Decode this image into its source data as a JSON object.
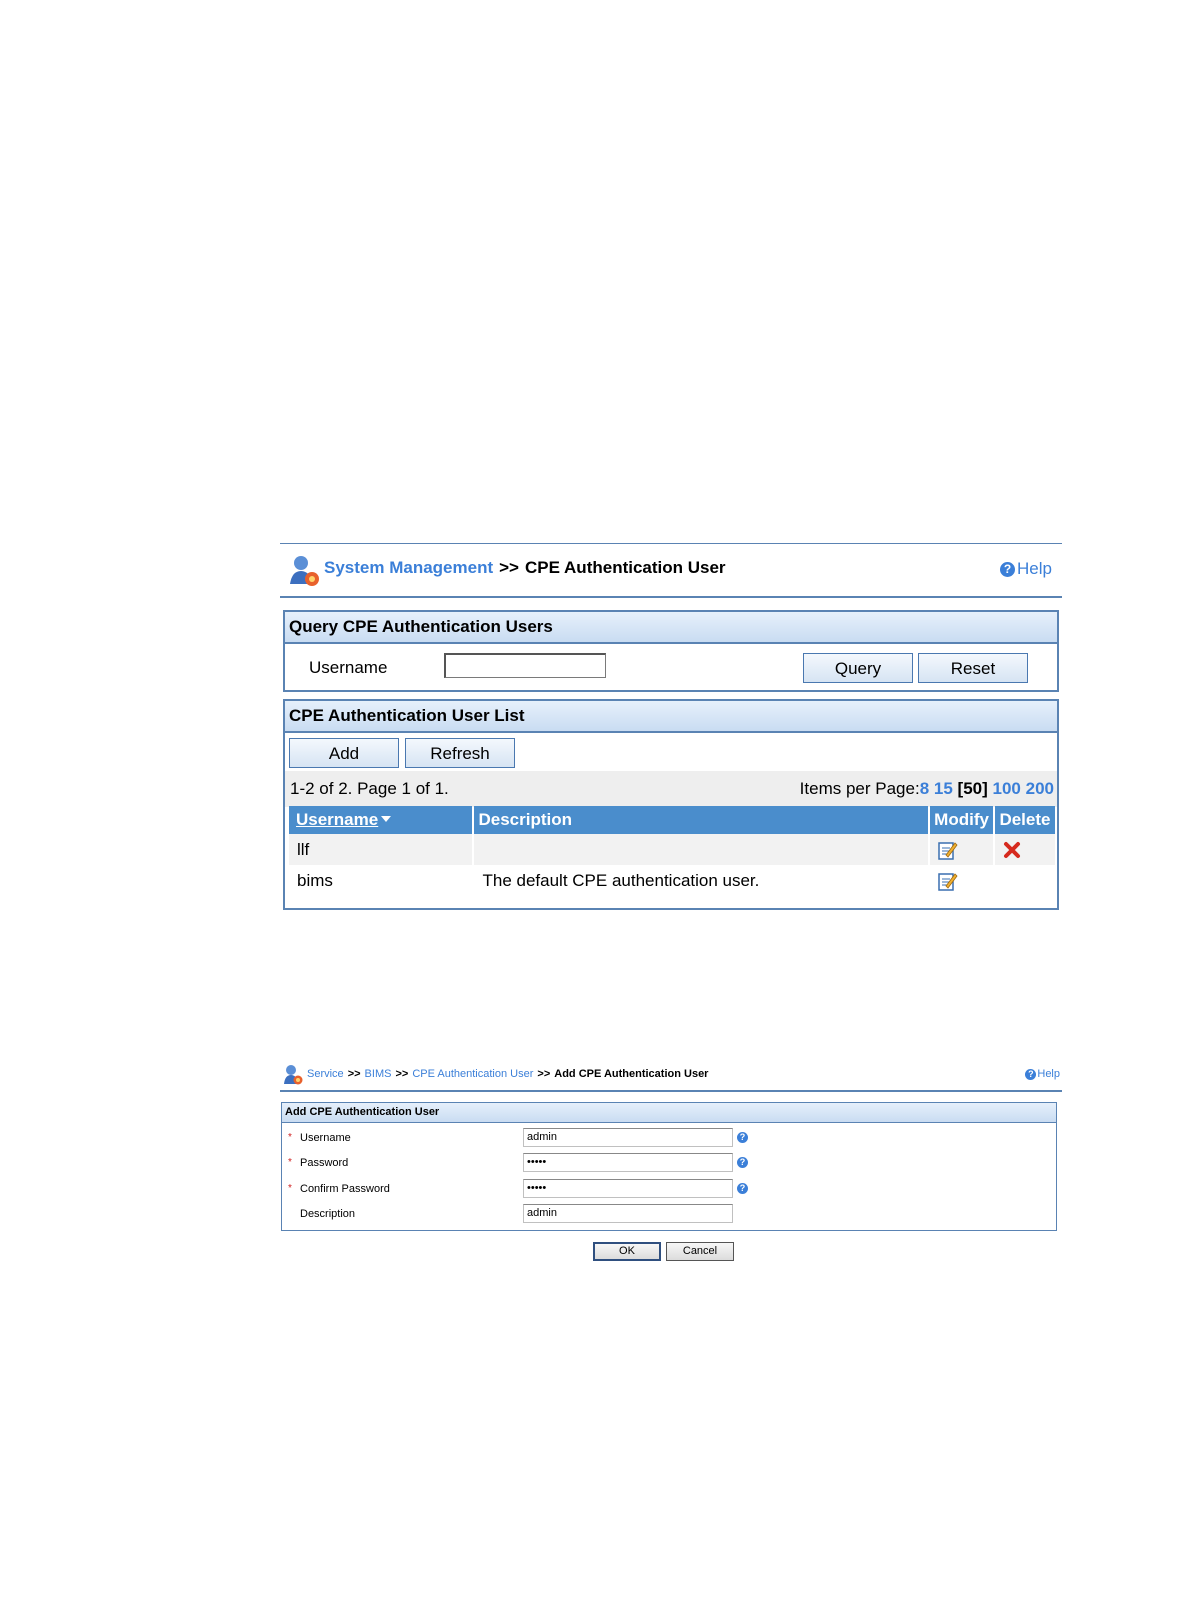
{
  "screen1": {
    "breadcrumb": {
      "section": "System Management",
      "separator": ">>",
      "page": "CPE Authentication User"
    },
    "help_label": "Help",
    "query_panel": {
      "title": "Query CPE Authentication Users",
      "username_label": "Username",
      "username_value": "",
      "query_button": "Query",
      "reset_button": "Reset"
    },
    "list_panel": {
      "title": "CPE Authentication User List",
      "add_button": "Add",
      "refresh_button": "Refresh",
      "page_info": "1-2 of 2. Page 1 of 1.",
      "items_per_page_label": "Items per Page:",
      "page_sizes": [
        "8",
        "15",
        "[50]",
        "100",
        "200"
      ],
      "columns": [
        "Username",
        "Description",
        "Modify",
        "Delete"
      ],
      "rows": [
        {
          "username": "llf",
          "description": "",
          "modify_icon": "edit-icon",
          "delete_icon": "delete-icon"
        },
        {
          "username": "bims",
          "description": "The default CPE authentication user.",
          "modify_icon": "edit-icon",
          "delete_icon": ""
        }
      ]
    }
  },
  "screen2": {
    "breadcrumb": [
      {
        "label": "Service"
      },
      {
        "label": "BIMS"
      },
      {
        "label": "CPE Authentication User"
      },
      {
        "label": "Add CPE Authentication User"
      }
    ],
    "separator": ">>",
    "help_label": "Help",
    "form": {
      "title": "Add CPE Authentication User",
      "required_marker": "*",
      "fields": [
        {
          "label": "Username",
          "value": "admin",
          "required": true
        },
        {
          "label": "Password",
          "value": "•••••",
          "required": true
        },
        {
          "label": "Confirm Password",
          "value": "•••••",
          "required": true
        },
        {
          "label": "Description",
          "value": "admin",
          "required": false
        }
      ]
    },
    "ok_button": "OK",
    "cancel_button": "Cancel"
  },
  "colors": {
    "link": "#3b7fd8",
    "border": "#5a83b3",
    "header": "#4a8dcc",
    "required": "#d02020"
  }
}
